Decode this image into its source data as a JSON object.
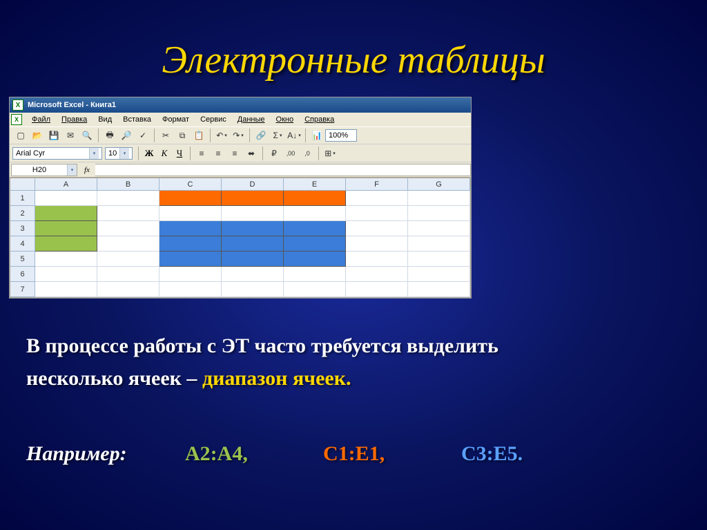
{
  "title": "Электронные таблицы",
  "excel": {
    "app_title": "Microsoft Excel - Книга1",
    "menus": {
      "file": "Файл",
      "edit": "Правка",
      "view": "Вид",
      "insert": "Вставка",
      "format": "Формат",
      "tools": "Сервис",
      "data": "Данные",
      "window": "Окно",
      "help": "Справка"
    },
    "zoom": "100%",
    "font_name": "Arial Cyr",
    "font_size": "10",
    "bold": "Ж",
    "italic": "К",
    "underline": "Ч",
    "name_box": "H20",
    "fx": "fx",
    "columns": [
      "A",
      "B",
      "C",
      "D",
      "E",
      "F",
      "G"
    ],
    "rows": [
      "1",
      "2",
      "3",
      "4",
      "5",
      "6",
      "7"
    ]
  },
  "paragraph": {
    "line1": "В процессе работы с ЭТ часто требуется выделить",
    "line2_a": "несколько ячеек – ",
    "line2_b": "диапазон ячеек."
  },
  "example": {
    "label": "Например:",
    "r1": "А2:А4,",
    "r2": "С1:Е1,",
    "r3": "С3:Е5."
  }
}
